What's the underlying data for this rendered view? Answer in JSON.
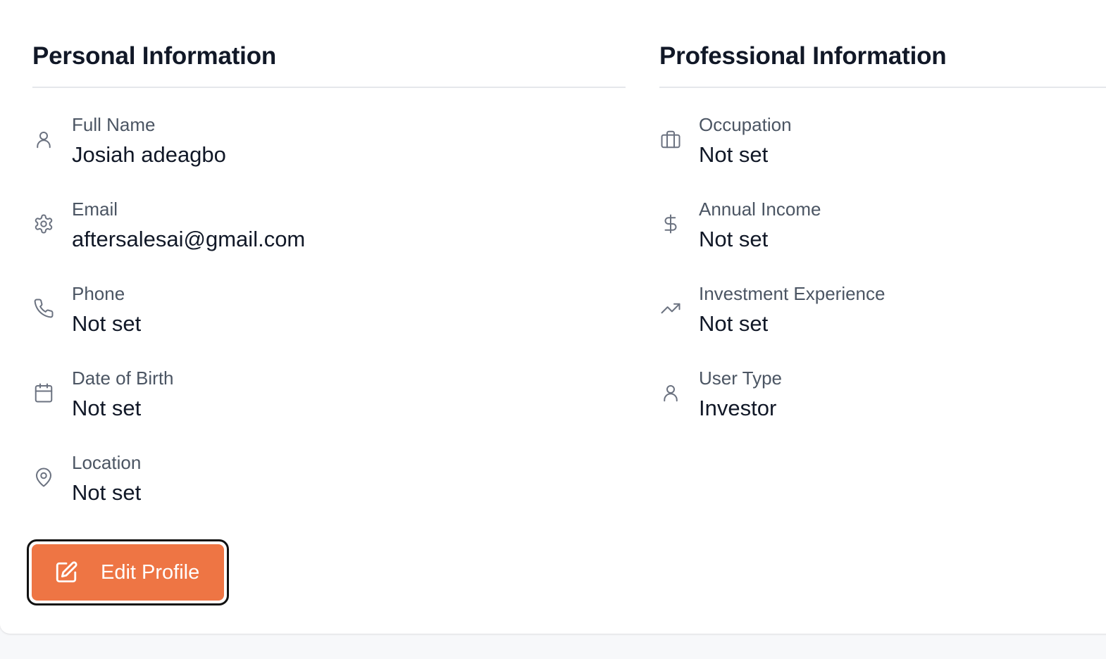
{
  "personal": {
    "title": "Personal Information",
    "fields": [
      {
        "label": "Full Name",
        "value": "Josiah adeagbo",
        "icon": "user-icon"
      },
      {
        "label": "Email",
        "value": "aftersalesai@gmail.com",
        "icon": "gear-icon"
      },
      {
        "label": "Phone",
        "value": "Not set",
        "icon": "phone-icon"
      },
      {
        "label": "Date of Birth",
        "value": "Not set",
        "icon": "calendar-icon"
      },
      {
        "label": "Location",
        "value": "Not set",
        "icon": "map-pin-icon"
      }
    ]
  },
  "professional": {
    "title": "Professional Information",
    "fields": [
      {
        "label": "Occupation",
        "value": "Not set",
        "icon": "briefcase-icon"
      },
      {
        "label": "Annual Income",
        "value": "Not set",
        "icon": "dollar-icon"
      },
      {
        "label": "Investment Experience",
        "value": "Not set",
        "icon": "trending-up-icon"
      },
      {
        "label": "User Type",
        "value": "Investor",
        "icon": "user-icon"
      }
    ]
  },
  "actions": {
    "edit_label": "Edit Profile",
    "edit_icon": "edit-icon"
  },
  "colors": {
    "accent": "#ee7544",
    "text_primary": "#111827",
    "text_secondary": "#4b5563",
    "divider": "#e5e7eb"
  }
}
